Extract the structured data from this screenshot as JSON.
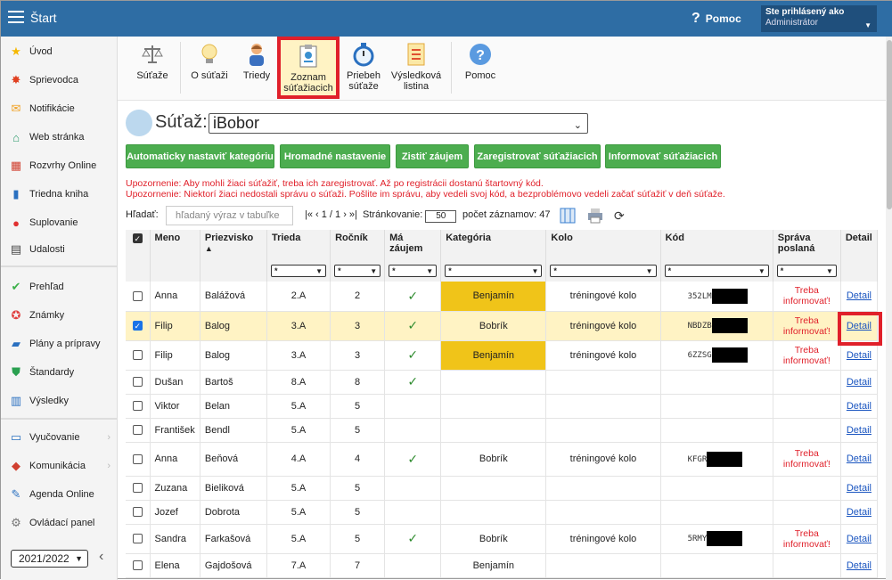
{
  "header": {
    "title": "Štart",
    "help_label": "Pomoc",
    "user_line1": "Ste prihlásený ako",
    "user_line2": "Administrátor"
  },
  "sidebar": {
    "items": [
      {
        "label": "Úvod",
        "icon": "star-icon"
      },
      {
        "label": "Sprievodca",
        "icon": "sparkle-icon"
      },
      {
        "label": "Notifikácie",
        "icon": "envelope-icon"
      },
      {
        "label": "Web stránka",
        "icon": "house-icon"
      },
      {
        "label": "Rozvrhy Online",
        "icon": "calendar-icon"
      },
      {
        "label": "Triedna kniha",
        "icon": "book-icon"
      },
      {
        "label": "Suplovanie",
        "icon": "person-icon"
      },
      {
        "label": "Udalosti",
        "icon": "calendar-icon"
      },
      {
        "label": "Prehľad",
        "icon": "check-circle-icon"
      },
      {
        "label": "Známky",
        "icon": "grade-icon"
      },
      {
        "label": "Plány a prípravy",
        "icon": "briefcase-icon"
      },
      {
        "label": "Štandardy",
        "icon": "shield-icon"
      },
      {
        "label": "Výsledky",
        "icon": "bar-chart-icon"
      },
      {
        "label": "Vyučovanie",
        "icon": "open-book-icon"
      },
      {
        "label": "Komunikácia",
        "icon": "chat-icon"
      },
      {
        "label": "Agenda Online",
        "icon": "pen-icon"
      },
      {
        "label": "Ovládací panel",
        "icon": "gear-icon"
      }
    ],
    "year": "2021/2022"
  },
  "toolbar": {
    "items": [
      {
        "label1": "Súťaže",
        "label2": "",
        "icon": "scales-icon"
      },
      {
        "label1": "O súťaži",
        "label2": "",
        "icon": "lightbulb-icon"
      },
      {
        "label1": "Triedy",
        "label2": "",
        "icon": "person-icon"
      },
      {
        "label1": "Zoznam",
        "label2": "súťažiacich",
        "icon": "clipboard-icon"
      },
      {
        "label1": "Priebeh",
        "label2": "súťaže",
        "icon": "stopwatch-icon"
      },
      {
        "label1": "Výsledková",
        "label2": "listina",
        "icon": "certificate-icon"
      },
      {
        "label1": "Pomoc",
        "label2": "",
        "icon": "help-icon"
      }
    ]
  },
  "competition": {
    "label": "Súťaž:",
    "value": "iBobor"
  },
  "actions": [
    "Automaticky nastaviť kategóriu",
    "Hromadné nastavenie",
    "Zistiť záujem",
    "Zaregistrovať súťažiacich",
    "Informovať súťažiacich"
  ],
  "warnings": [
    "Upozornenie: Aby mohli žiaci súťažiť, treba ich zaregistrovať. Až po registrácii dostanú štartovný kód.",
    "Upozornenie: Niektorí žiaci nedostali správu o súťaži. Pošlite im správu, aby vedeli svoj kód, a bezproblémovo vedeli začať súťažiť v deň súťaže."
  ],
  "search": {
    "label": "Hľadať:",
    "placeholder": "hľadaný výraz v tabuľke",
    "pager": "|« ‹ 1 / 1 › »|",
    "paging_label": "Stránkovanie:",
    "page_size": "50",
    "count": "počet záznamov: 47"
  },
  "table": {
    "headers": {
      "meno": "Meno",
      "priezvisko": "Priezvisko",
      "trieda": "Trieda",
      "rocnik": "Ročník",
      "zaujem1": "Má",
      "zaujem2": "záujem",
      "kategoria": "Kategória",
      "kolo": "Kolo",
      "kod": "Kód",
      "sprava1": "Správa",
      "sprava2": "poslaná",
      "detail": "Detail"
    },
    "filter": "*",
    "rows": [
      {
        "meno": "Anna",
        "priezvisko": "Balážová",
        "trieda": "2.A",
        "rocnik": "2",
        "zaujem": "✓",
        "kategoria": "Benjamín",
        "kolo": "tréningové kolo",
        "kod": "352LM",
        "sprava1": "Treba",
        "sprava2": "informovať!",
        "detail": "Detail"
      },
      {
        "meno": "Filip",
        "priezvisko": "Balog",
        "trieda": "3.A",
        "rocnik": "3",
        "zaujem": "✓",
        "kategoria": "Bobrík",
        "kolo": "tréningové kolo",
        "kod": "NBDZB",
        "sprava1": "Treba",
        "sprava2": "informovať!",
        "detail": "Detail"
      },
      {
        "meno": "Filip",
        "priezvisko": "Balog",
        "trieda": "3.A",
        "rocnik": "3",
        "zaujem": "✓",
        "kategoria": "Benjamín",
        "kolo": "tréningové kolo",
        "kod": "6ZZSG",
        "sprava1": "Treba",
        "sprava2": "informovať!",
        "detail": "Detail"
      },
      {
        "meno": "Dušan",
        "priezvisko": "Bartoš",
        "trieda": "8.A",
        "rocnik": "8",
        "zaujem": "✓",
        "kategoria": "",
        "kolo": "",
        "kod": "",
        "sprava1": "",
        "sprava2": "",
        "detail": "Detail"
      },
      {
        "meno": "Viktor",
        "priezvisko": "Belan",
        "trieda": "5.A",
        "rocnik": "5",
        "zaujem": "",
        "kategoria": "",
        "kolo": "",
        "kod": "",
        "sprava1": "",
        "sprava2": "",
        "detail": "Detail"
      },
      {
        "meno": "František",
        "priezvisko": "Bendl",
        "trieda": "5.A",
        "rocnik": "5",
        "zaujem": "",
        "kategoria": "",
        "kolo": "",
        "kod": "",
        "sprava1": "",
        "sprava2": "",
        "detail": "Detail"
      },
      {
        "meno": "Anna",
        "priezvisko": "Beňová",
        "trieda": "4.A",
        "rocnik": "4",
        "zaujem": "✓",
        "kategoria": "Bobrík",
        "kolo": "tréningové kolo",
        "kod": "KFGR",
        "sprava1": "Treba",
        "sprava2": "informovať!",
        "detail": "Detail"
      },
      {
        "meno": "Zuzana",
        "priezvisko": "Bieliková",
        "trieda": "5.A",
        "rocnik": "5",
        "zaujem": "",
        "kategoria": "",
        "kolo": "",
        "kod": "",
        "sprava1": "",
        "sprava2": "",
        "detail": "Detail"
      },
      {
        "meno": "Jozef",
        "priezvisko": "Dobrota",
        "trieda": "5.A",
        "rocnik": "5",
        "zaujem": "",
        "kategoria": "",
        "kolo": "",
        "kod": "",
        "sprava1": "",
        "sprava2": "",
        "detail": "Detail"
      },
      {
        "meno": "Sandra",
        "priezvisko": "Farkašová",
        "trieda": "5.A",
        "rocnik": "5",
        "zaujem": "✓",
        "kategoria": "Bobrík",
        "kolo": "tréningové kolo",
        "kod": "5RMY",
        "sprava1": "Treba",
        "sprava2": "informovať!",
        "detail": "Detail"
      },
      {
        "meno": "Elena",
        "priezvisko": "Gajdošová",
        "trieda": "7.A",
        "rocnik": "7",
        "zaujem": "",
        "kategoria": "Benjamín",
        "kolo": "",
        "kod": "",
        "sprava1": "",
        "sprava2": "",
        "detail": "Detail"
      }
    ]
  },
  "colors": {
    "topbar": "#2e6da4",
    "green": "#4cad4f",
    "warning": "#e0202a",
    "highlight": "#f0c419",
    "selected_row": "#fff3c4"
  }
}
